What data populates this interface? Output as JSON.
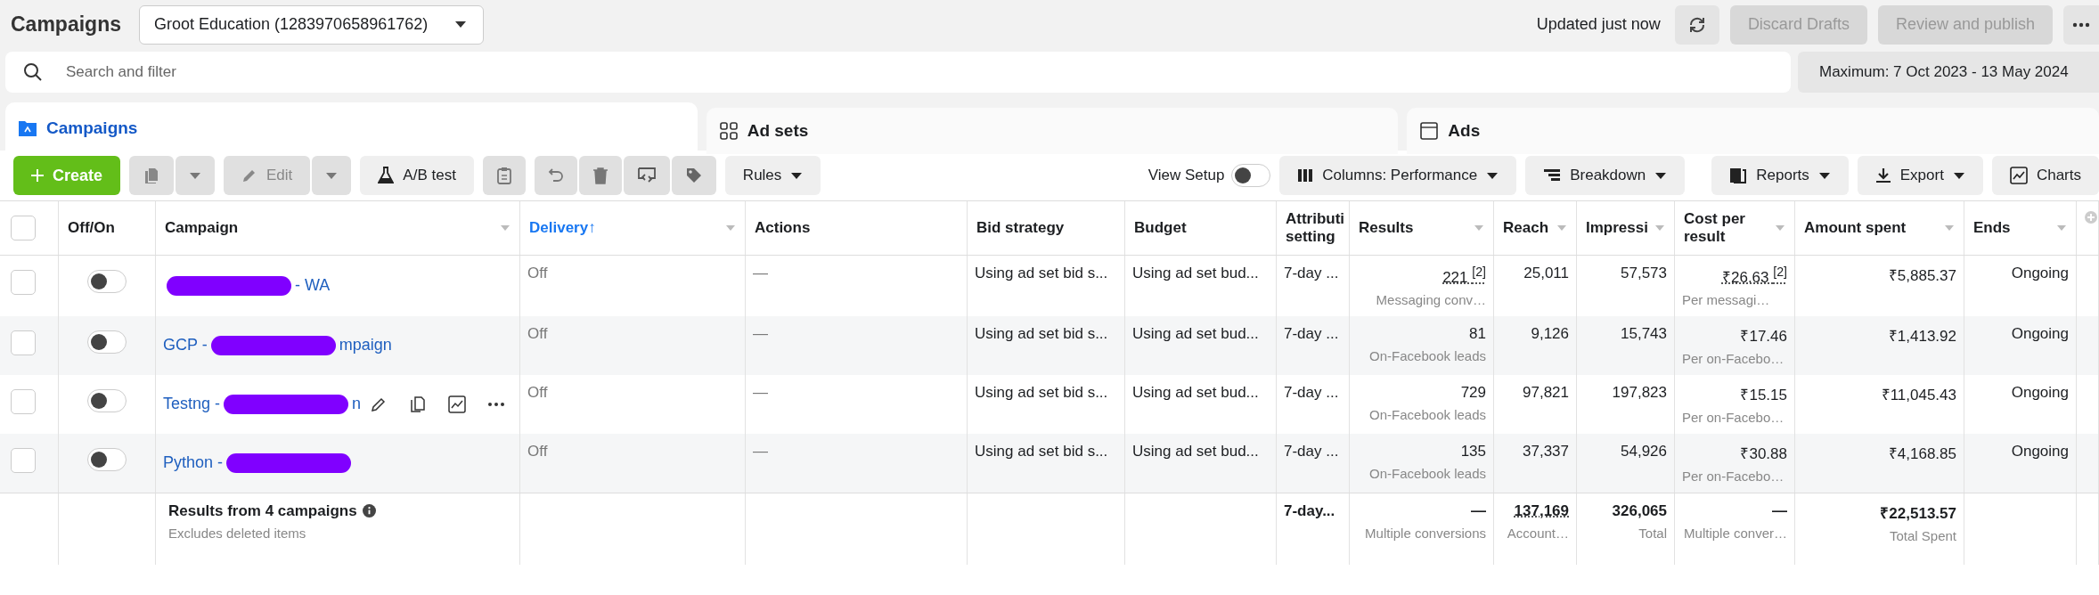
{
  "header": {
    "title": "Campaigns",
    "account": "Groot Education (1283970658961762)",
    "updated": "Updated just now",
    "discard": {
      "label": "Discard Drafts",
      "disabled": true
    },
    "publish": {
      "label": "Review and publish",
      "disabled": true
    }
  },
  "search": {
    "placeholder": "Search and filter"
  },
  "date_range": "Maximum: 7 Oct 2023 - 13 May 2024",
  "tabs": [
    {
      "label": "Campaigns",
      "selected": true
    },
    {
      "label": "Ad sets",
      "selected": false
    },
    {
      "label": "Ads",
      "selected": false
    }
  ],
  "toolbar": {
    "create": "Create",
    "duplicate_disabled": true,
    "edit": {
      "label": "Edit",
      "disabled": true
    },
    "ab_test": "A/B test",
    "clipboard_disabled": true,
    "rules": "Rules",
    "view_setup": {
      "label": "View Setup",
      "on": false
    },
    "columns": "Columns: Performance",
    "breakdown": "Breakdown",
    "reports": "Reports",
    "export": "Export",
    "charts": "Charts"
  },
  "table": {
    "select_all_checked": false,
    "columns": [
      {
        "label": "Off/On",
        "sorted": false,
        "menu": false
      },
      {
        "label": "Campaign",
        "sorted": false,
        "menu": true
      },
      {
        "label": "Delivery",
        "sorted": true,
        "sort_arrow": "↑",
        "menu": true
      },
      {
        "label": "Actions",
        "sorted": false,
        "menu": false
      },
      {
        "label": "Bid strategy",
        "sorted": false,
        "menu": false
      },
      {
        "label": "Budget",
        "sorted": false,
        "menu": false
      },
      {
        "label": "Attributi setting",
        "sorted": false,
        "menu": false
      },
      {
        "label": "Results",
        "sorted": false,
        "menu": true
      },
      {
        "label": "Reach",
        "sorted": false,
        "menu": true
      },
      {
        "label": "Impressi",
        "sorted": false,
        "menu": true
      },
      {
        "label": "Cost per result",
        "sorted": false,
        "menu": true
      },
      {
        "label": "Amount spent",
        "sorted": false,
        "menu": true
      },
      {
        "label": "Ends",
        "sorted": false,
        "menu": true
      }
    ],
    "rows": [
      {
        "checked": false,
        "on": false,
        "name_after": "- WA",
        "redacted": true,
        "show_actions": false,
        "delivery": "Off",
        "actions": "—",
        "bid": "Using ad set bid s...",
        "budget": "Using ad set bud...",
        "attribution": "7-day ...",
        "results": "221 $^{[2]}$",
        "results_underlined": true,
        "results_sub": "Messaging conv…",
        "reach": "25,011",
        "impressions": "57,573",
        "cost": "₹26.63 $^{[2]}$",
        "cost_underlined": true,
        "cost_sub": "Per messagi…",
        "amount": "₹5,885.37",
        "ends": "Ongoing"
      },
      {
        "checked": false,
        "on": false,
        "name_before": "GCP -",
        "name_after": "mpaign",
        "redacted": true,
        "show_actions": false,
        "delivery": "Off",
        "actions": "—",
        "bid": "Using ad set bid s...",
        "budget": "Using ad set bud...",
        "attribution": "7-day ...",
        "results": "81",
        "results_underlined": false,
        "results_sub": "On-Facebook leads",
        "reach": "9,126",
        "impressions": "15,743",
        "cost": "₹17.46",
        "cost_underlined": false,
        "cost_sub": "Per on-Facebo…",
        "amount": "₹1,413.92",
        "ends": "Ongoing"
      },
      {
        "checked": false,
        "on": false,
        "name_before": "Testng -",
        "name_after": "n",
        "redacted": true,
        "show_actions": true,
        "delivery": "Off",
        "actions": "—",
        "bid": "Using ad set bid s...",
        "budget": "Using ad set bud...",
        "attribution": "7-day ...",
        "results": "729",
        "results_underlined": false,
        "results_sub": "On-Facebook leads",
        "reach": "97,821",
        "impressions": "197,823",
        "cost": "₹15.15",
        "cost_underlined": false,
        "cost_sub": "Per on-Facebo…",
        "amount": "₹11,045.43",
        "ends": "Ongoing"
      },
      {
        "checked": false,
        "on": false,
        "name_before": "Python -",
        "redacted": true,
        "show_actions": false,
        "delivery": "Off",
        "actions": "—",
        "bid": "Using ad set bid s...",
        "budget": "Using ad set bud...",
        "attribution": "7-day ...",
        "results": "135",
        "results_underlined": false,
        "results_sub": "On-Facebook leads",
        "reach": "37,337",
        "impressions": "54,926",
        "cost": "₹30.88",
        "cost_underlined": false,
        "cost_sub": "Per on-Facebo…",
        "amount": "₹4,168.85",
        "ends": "Ongoing"
      }
    ],
    "totals": {
      "label": "Results from 4 campaigns",
      "sub": "Excludes deleted items",
      "attribution": "7-day...",
      "results": "—",
      "results_sub": "Multiple conversions",
      "reach": "137,169",
      "reach_sub": "Account…",
      "impressions": "326,065",
      "impressions_sub": "Total",
      "cost": "—",
      "cost_sub": "Multiple conver…",
      "amount": "₹22,513.57",
      "amount_sub": "Total Spent"
    }
  }
}
